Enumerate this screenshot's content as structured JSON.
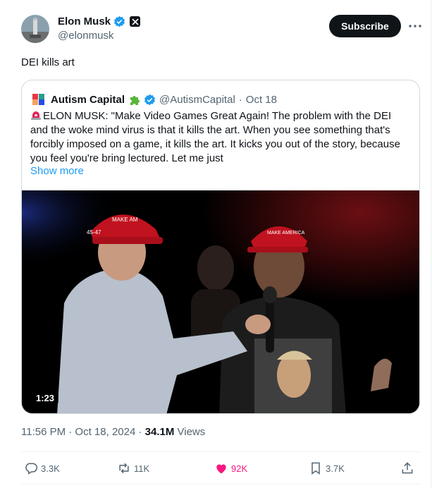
{
  "author": {
    "name": "Elon Musk",
    "handle": "@elonmusk",
    "avatar_icon": "rocket-launch-avatar"
  },
  "subscribe_label": "Subscribe",
  "tweet_text": "DEI kills art",
  "quote": {
    "name": "Autism Capital",
    "handle": "@AutismCapital",
    "separator": "·",
    "date": "Oct 18",
    "body": "ELON MUSK: \"Make Video Games Great Again! The problem with the DEI and the woke mind virus is that it kills the art. When you see something that's forcibly imposed on a game, it kills the art. It kicks you out of the story, because you feel you're bring lectured. Let me just",
    "show_more": "Show more",
    "video_duration": "1:23"
  },
  "meta": {
    "time": "11:56 PM · Oct 18, 2024 · ",
    "views_count": "34.1M",
    "views_label": " Views"
  },
  "actions": {
    "replies": "3.3K",
    "reposts": "11K",
    "likes": "92K",
    "bookmarks": "3.7K"
  },
  "colors": {
    "accent": "#1d9bf0",
    "like": "#f91880",
    "text": "#0f1419",
    "secondary": "#536471"
  }
}
